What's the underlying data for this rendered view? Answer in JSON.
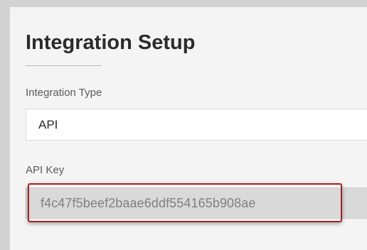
{
  "form": {
    "title": "Integration Setup",
    "integration_type": {
      "label": "Integration Type",
      "value": "API"
    },
    "api_key": {
      "label": "API Key",
      "value": "f4c47f5beef2baae6ddf554165b908ae"
    }
  },
  "colors": {
    "highlight_border": "#a42222",
    "panel_background": "#f4f4f4",
    "readonly_field_background": "#d9d9d9"
  }
}
